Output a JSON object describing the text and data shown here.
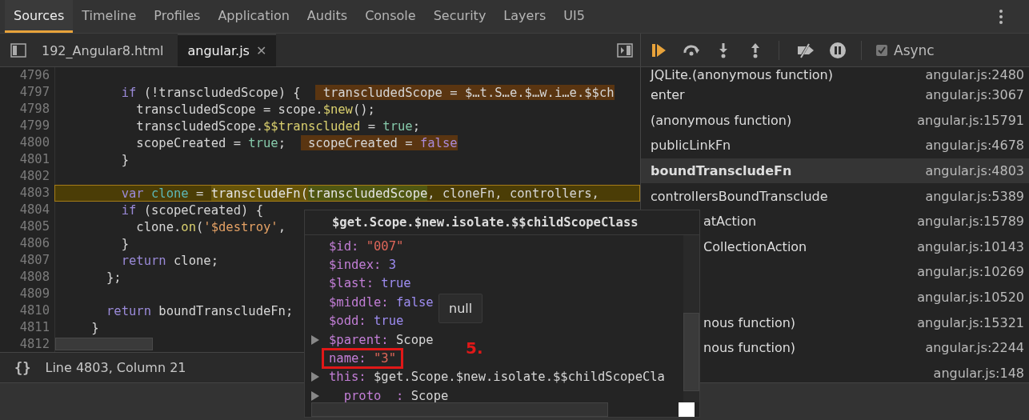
{
  "top_tabs": [
    {
      "label": "Sources",
      "selected": true
    },
    {
      "label": "Timeline",
      "selected": false
    },
    {
      "label": "Profiles",
      "selected": false
    },
    {
      "label": "Application",
      "selected": false
    },
    {
      "label": "Audits",
      "selected": false
    },
    {
      "label": "Console",
      "selected": false
    },
    {
      "label": "Security",
      "selected": false
    },
    {
      "label": "Layers",
      "selected": false
    },
    {
      "label": "UI5",
      "selected": false
    }
  ],
  "file_tabs": [
    {
      "label": "192_Angular8.html",
      "selected": false
    },
    {
      "label": "angular.js",
      "selected": true,
      "close": "✕"
    }
  ],
  "code": {
    "lines": [
      {
        "number": "4796",
        "current": false
      },
      {
        "number": "4797",
        "current": false,
        "tokens": [
          {
            "kind": "keyword",
            "text": "        if"
          },
          {
            "kind": "plain",
            "text": " (!transcludedScope) {  "
          },
          {
            "kind": "inline",
            "text": " transcludedScope = $…t.S…e.$…w.i…e.$$ch"
          }
        ]
      },
      {
        "number": "4798",
        "current": false,
        "tokens": [
          {
            "kind": "plain",
            "text": "          transcludedScope = scope."
          },
          {
            "kind": "property",
            "text": "$new"
          },
          {
            "kind": "plain",
            "text": "();"
          }
        ]
      },
      {
        "number": "4799",
        "current": false,
        "tokens": [
          {
            "kind": "plain",
            "text": "          transcludedScope."
          },
          {
            "kind": "property",
            "text": "$$transcluded"
          },
          {
            "kind": "plain",
            "text": " = "
          },
          {
            "kind": "literal",
            "text": "true"
          },
          {
            "kind": "plain",
            "text": ";"
          }
        ]
      },
      {
        "number": "4800",
        "current": false,
        "tokens": [
          {
            "kind": "plain",
            "text": "          scopeCreated = "
          },
          {
            "kind": "literal",
            "text": "true"
          },
          {
            "kind": "plain",
            "text": ";  "
          },
          {
            "kind": "inline",
            "text": " scopeCreated = "
          },
          {
            "kind": "inline_keyword",
            "text": "false"
          }
        ]
      },
      {
        "number": "4801",
        "current": false,
        "tokens": [
          {
            "kind": "plain",
            "text": "        }"
          }
        ]
      },
      {
        "number": "4802",
        "current": false
      },
      {
        "number": "4803",
        "current": true,
        "tokens": [
          {
            "kind": "keyword",
            "text": "        var"
          },
          {
            "kind": "definition",
            "text": " clone"
          },
          {
            "kind": "plain",
            "text": " = "
          },
          {
            "kind": "call_highlight",
            "text": "transcludeFn("
          },
          {
            "kind": "arg_highlight",
            "text": "transcludedScope"
          },
          {
            "kind": "plain",
            "text": ", cloneFn, controllers, "
          }
        ]
      },
      {
        "number": "4804",
        "current": false,
        "tokens": [
          {
            "kind": "keyword",
            "text": "        if"
          },
          {
            "kind": "plain",
            "text": " (scopeCreated) {"
          }
        ]
      },
      {
        "number": "4805",
        "current": false,
        "tokens": [
          {
            "kind": "plain",
            "text": "          clone."
          },
          {
            "kind": "property",
            "text": "on"
          },
          {
            "kind": "plain",
            "text": "("
          },
          {
            "kind": "string",
            "text": "'$destroy'"
          },
          {
            "kind": "plain",
            "text": ","
          }
        ]
      },
      {
        "number": "4806",
        "current": false,
        "tokens": [
          {
            "kind": "plain",
            "text": "        }"
          }
        ]
      },
      {
        "number": "4807",
        "current": false,
        "tokens": [
          {
            "kind": "keyword",
            "text": "        return"
          },
          {
            "kind": "plain",
            "text": " clone;"
          }
        ]
      },
      {
        "number": "4808",
        "current": false,
        "tokens": [
          {
            "kind": "plain",
            "text": "      };"
          }
        ]
      },
      {
        "number": "4809",
        "current": false
      },
      {
        "number": "4810",
        "current": false,
        "tokens": [
          {
            "kind": "keyword",
            "text": "      return"
          },
          {
            "kind": "plain",
            "text": " boundTranscludeFn;"
          }
        ]
      },
      {
        "number": "4811",
        "current": false,
        "tokens": [
          {
            "kind": "plain",
            "text": "    }"
          }
        ]
      },
      {
        "number": "4812",
        "current": false
      }
    ]
  },
  "status_bar": {
    "pretty_print": "{}",
    "position": "Line 4803, Column 21"
  },
  "debug_toolbar": {
    "async": {
      "label": "Async",
      "checked": true
    }
  },
  "call_stack": [
    {
      "kind": "full",
      "name": "JQLite.(anonymous function)",
      "location": "angular.js:2480",
      "selected": false
    },
    {
      "kind": "full",
      "name": "enter",
      "location": "angular.js:3067",
      "selected": false
    },
    {
      "kind": "full",
      "name": "(anonymous function)",
      "location": "angular.js:15791",
      "selected": false
    },
    {
      "kind": "full",
      "name": "publicLinkFn",
      "location": "angular.js:4678",
      "selected": false
    },
    {
      "kind": "full",
      "name": "boundTranscludeFn",
      "location": "angular.js:4803",
      "selected": true
    },
    {
      "kind": "full",
      "name": "controllersBoundTransclude",
      "location": "angular.js:5389",
      "selected": false
    },
    {
      "kind": "covered",
      "name": "atAction",
      "location": "angular.js:15789",
      "selected": false
    },
    {
      "kind": "covered",
      "name": "CollectionAction",
      "location": "angular.js:10143",
      "selected": false
    },
    {
      "kind": "covered",
      "location": "angular.js:10269",
      "selected": false
    },
    {
      "kind": "covered",
      "location": "angular.js:10520",
      "selected": false
    },
    {
      "kind": "covered",
      "name": "nous function)",
      "location": "angular.js:15321",
      "selected": false
    },
    {
      "kind": "covered",
      "name": "nous function)",
      "location": "angular.js:2244",
      "selected": false
    },
    {
      "kind": "covered",
      "location": "angular.js:148",
      "selected": false
    }
  ],
  "popover": {
    "title": "$get.Scope.$new.isolate.$$childScopeClass",
    "properties": [
      {
        "key": "$id:",
        "value": "\"007\"",
        "kind": "string"
      },
      {
        "key": "$index:",
        "value": "3",
        "kind": "number"
      },
      {
        "key": "$last:",
        "value": "true",
        "kind": "boolean"
      },
      {
        "key": "$middle:",
        "value": "false",
        "kind": "boolean"
      },
      {
        "key": "$odd:",
        "value": "true",
        "kind": "boolean"
      },
      {
        "key": "$parent:",
        "value": "Scope",
        "kind": "object",
        "expanded": false
      },
      {
        "key": "name:",
        "value": "\"3\"",
        "kind": "string",
        "annotated": true
      },
      {
        "key": "this:",
        "value": "$get.Scope.$new.isolate.$$childScopeCla",
        "kind": "object",
        "expanded": false
      },
      {
        "key": "__proto__:",
        "value": "Scope",
        "kind": "object",
        "expanded": false
      }
    ]
  },
  "tooltip": {
    "text": "null"
  },
  "annotation": {
    "text": "5."
  }
}
